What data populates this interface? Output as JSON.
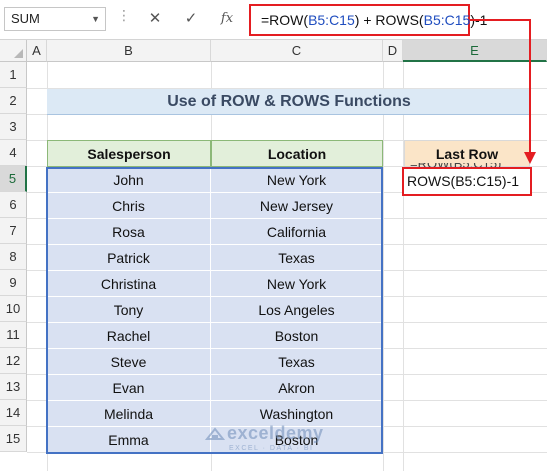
{
  "formula_bar": {
    "name_box": "SUM",
    "formula_parts": [
      "=ROW(",
      "B5:C15",
      ") + ROWS(",
      "B5:C15",
      ")-1"
    ]
  },
  "columns": [
    "A",
    "B",
    "C",
    "D",
    "E"
  ],
  "rows": [
    "1",
    "2",
    "3",
    "4",
    "5",
    "6",
    "7",
    "8",
    "9",
    "10",
    "11",
    "12",
    "13",
    "14",
    "15"
  ],
  "title": "Use of ROW & ROWS Functions",
  "table": {
    "headers": [
      "Salesperson",
      "Location"
    ],
    "rows": [
      [
        "John",
        "New York"
      ],
      [
        "Chris",
        "New Jersey"
      ],
      [
        "Rosa",
        "California"
      ],
      [
        "Patrick",
        "Texas"
      ],
      [
        "Christina",
        "New York"
      ],
      [
        "Tony",
        "Los Angeles"
      ],
      [
        "Rachel",
        "Boston"
      ],
      [
        "Steve",
        "Texas"
      ],
      [
        "Evan",
        "Akron"
      ],
      [
        "Melinda",
        "Washington"
      ],
      [
        "Emma",
        "Boston"
      ]
    ]
  },
  "last_row": {
    "header": "Last Row",
    "ghost_text": "=ROW(B5:C15)",
    "editing_text": "ROWS(B5:C15)-1"
  },
  "watermark": {
    "name": "exceldemy",
    "tagline": "EXCEL · DATA · BI"
  },
  "colors": {
    "accent_red": "#e41d21",
    "table_blue": "#4472c4",
    "header_green": "#e2efda",
    "lastrow_orange": "#fbe5c8"
  }
}
